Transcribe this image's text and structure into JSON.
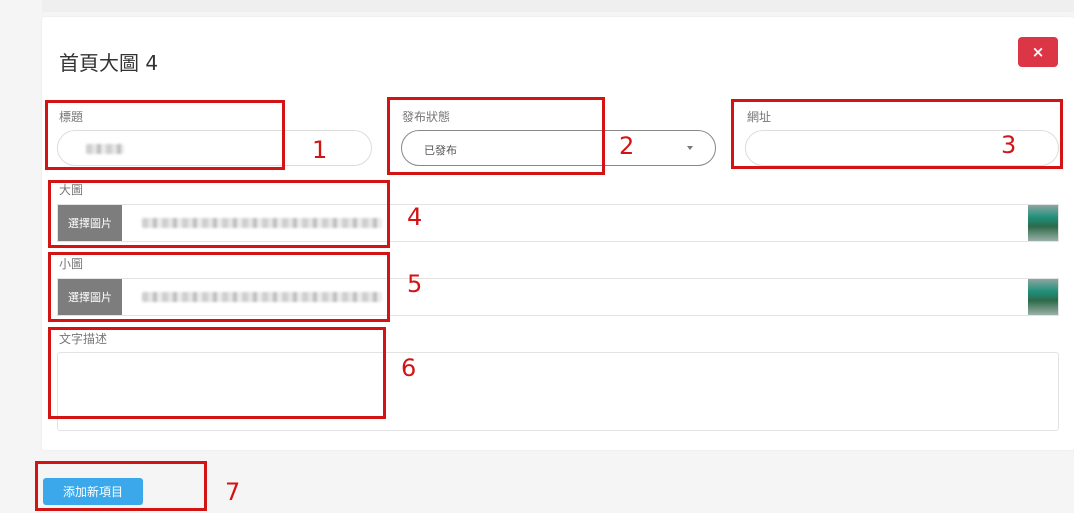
{
  "modal": {
    "title": "首頁大圖 4",
    "close_icon": "×"
  },
  "fields": {
    "title_label": "標題",
    "status_label": "發布狀態",
    "status_value": "已發布",
    "url_label": "網址",
    "url_value": "",
    "large_image_label": "大圖",
    "small_image_label": "小圖",
    "choose_image_label": "選擇圖片",
    "description_label": "文字描述",
    "description_value": ""
  },
  "actions": {
    "add_item_label": "添加新項目"
  },
  "annotations": [
    "1",
    "2",
    "3",
    "4",
    "5",
    "6",
    "7"
  ],
  "colors": {
    "close_button": "#dc3545",
    "add_button": "#3aa8ea",
    "annotation": "#d31414",
    "file_button": "#7d7d7d"
  }
}
